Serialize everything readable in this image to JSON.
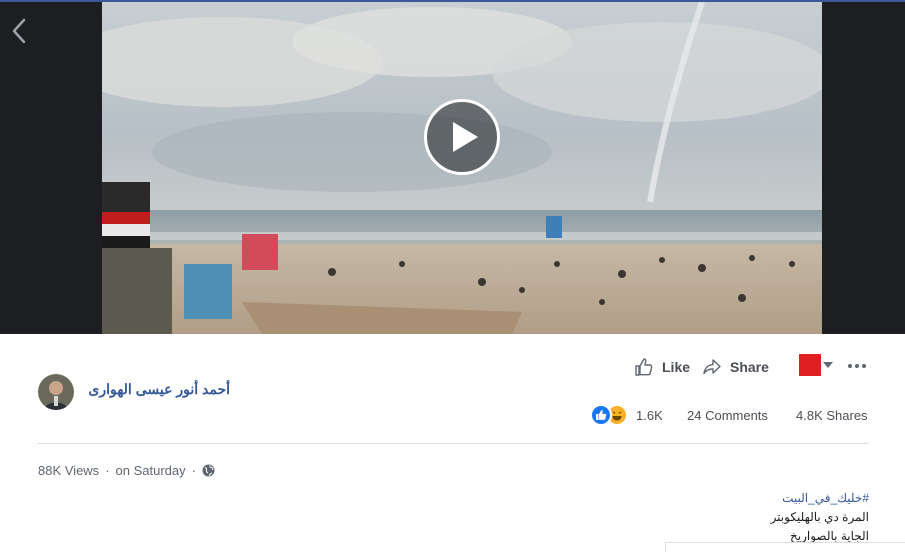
{
  "video": {
    "back_icon": "chevron-left-icon",
    "play_icon": "play-icon"
  },
  "actions": {
    "like_label": "Like",
    "share_label": "Share",
    "more_icon": "more-icon",
    "flag_color": "#e02020"
  },
  "post": {
    "author_name": "أحمد أنور عيسى الهوارى",
    "reactions_count": "1.6K",
    "comments": "24 Comments",
    "shares": "4.8K Shares",
    "views": "88K Views",
    "separator": "·",
    "time": "on Saturday",
    "caption_lines": [
      "#خليك_في_البيت",
      "المرة دي بالهليكوبتر",
      "الجاية بالصواريخ"
    ]
  },
  "colors": {
    "link": "#365899",
    "like_blue": "#1877f2",
    "haha_yellow": "#f7b125"
  }
}
